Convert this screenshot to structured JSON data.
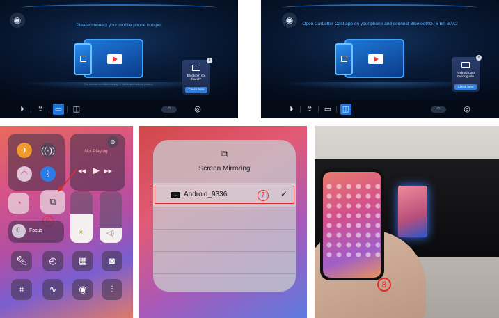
{
  "car_screens": [
    {
      "message": "Please connect your mobile phone hotspot",
      "subtext": "The screen on video turning in (write and restore phone)",
      "card_text": "Bluetooth not found?",
      "card_button": "Check here",
      "dock_icons": [
        "play-circle-icon",
        "upload-screen-icon",
        "cast-screen-icon",
        "airplay-icon",
        "wifi-pill-icon",
        "settings-icon"
      ],
      "active_dock": 2
    },
    {
      "message": "Open CarLetter Cast app on your phone and connect BluetoothGT6-BT-B7A2",
      "card_text": "Android Cast Quick guide",
      "card_button": "Check here",
      "dock_icons": [
        "play-circle-icon",
        "upload-screen-icon",
        "cast-screen-icon",
        "airplay-icon",
        "wifi-pill-icon",
        "settings-icon"
      ],
      "active_dock": 3
    }
  ],
  "control_center": {
    "now_playing": "Not Playing",
    "focus_label": "Focus",
    "step_marker": "6",
    "brightness_level": 0.55,
    "volume_level": 0.3
  },
  "screen_mirroring": {
    "title": "Screen Mirroring",
    "device": "Android_9336",
    "device_badge": "tv",
    "step_marker": "7"
  },
  "photo": {
    "step_marker": "8"
  },
  "colors": {
    "car_text": "#58b6ff",
    "accent_red": "#e32b2b",
    "car_active": "#1f74d8"
  }
}
